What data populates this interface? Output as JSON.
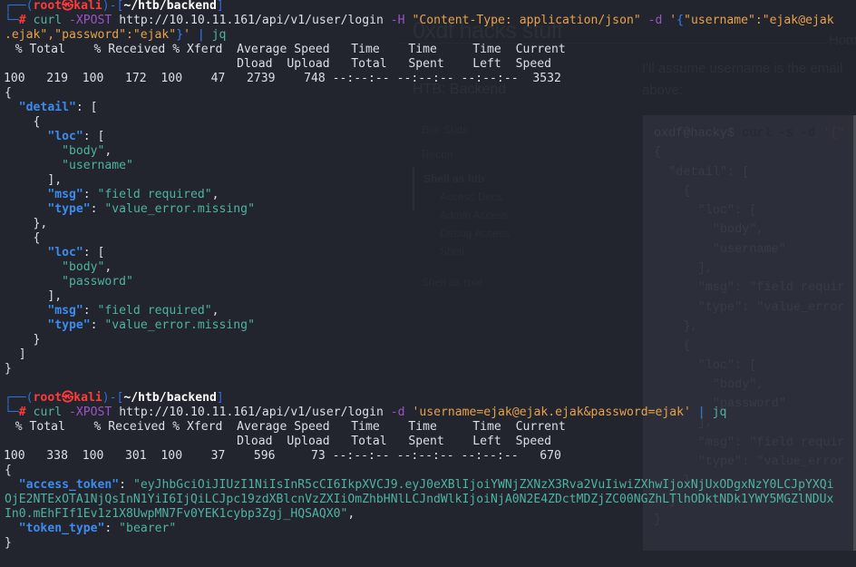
{
  "background_page": {
    "site_title": "0xdf hacks stuff",
    "nav_home": "Hom",
    "post_title": "HTB: Backend",
    "intro_text": "I'll assume username is the email above:",
    "toc": {
      "items": [
        {
          "label": "Box Stats",
          "level": 1
        },
        {
          "label": "Recon",
          "level": 1
        },
        {
          "label": "Shell as htb",
          "level": 1,
          "active": true
        },
        {
          "label": "Access Docs",
          "level": 2
        },
        {
          "label": "Admin Access",
          "level": 2
        },
        {
          "label": "Debug Access",
          "level": 2
        },
        {
          "label": "Shell",
          "level": 2
        },
        {
          "label": "Shell as root",
          "level": 1
        }
      ]
    },
    "code_block": {
      "prompt": "oxdf@hacky$",
      "command": " curl -s -d ",
      "arg": "'{\"",
      "lines": [
        "{",
        "  \"detail\": [",
        "    {",
        "      \"loc\": [",
        "        \"body\",",
        "        \"username\"",
        "      ],",
        "      \"msg\": \"field requir",
        "      \"type\": \"value_error",
        "    },",
        "    {",
        "      \"loc\": [",
        "        \"body\",",
        "        \"password\"",
        "      ],",
        "      \"msg\": \"field requir",
        "      \"type\": \"value_error",
        "    }",
        "  ]",
        "}"
      ]
    }
  },
  "terminal": {
    "prompt": {
      "user": "root",
      "at_symbol": "㉿",
      "host": "kali",
      "cwd": "~/htb/backend",
      "hash": "#"
    },
    "command1": {
      "program": "curl",
      "flag1": "-XPOST",
      "url": "http://10.10.11.161/api/v1/user/login",
      "flag2": "-H",
      "header": "\"Content-Type: application/json\"",
      "flag3": "-d",
      "body_open": "'",
      "brace": "{",
      "body_line1": "\"username\":\"ejak@ejak",
      "body_line2": ".ejak\",\"password\":\"ejak\"",
      "brace_close": "}",
      "body_close": "'",
      "pipe": "|",
      "pipe_to": "jq"
    },
    "progress_header1": "  % Total    % Received % Xferd  Average Speed   Time    Time     Time  Current",
    "progress_header2": "                                 Dload  Upload   Total   Spent    Left  Speed",
    "progress1": "100   219  100   172  100    47   2739    748 --:--:-- --:--:-- --:--:--  3532",
    "response1": {
      "detail": [
        {
          "loc": [
            "body",
            "username"
          ],
          "msg": "field required",
          "type": "value_error.missing"
        },
        {
          "loc": [
            "body",
            "password"
          ],
          "msg": "field required",
          "type": "value_error.missing"
        }
      ]
    },
    "command2": {
      "program": "curl",
      "flag1": "-XPOST",
      "url": "http://10.10.11.161/api/v1/user/login",
      "flag2": "-d",
      "body": "'username=ejak@ejak.ejak&password=ejak'",
      "pipe": "|",
      "pipe_to": "jq"
    },
    "progress2": "100   338  100   301  100    37    596     73 --:--:-- --:--:-- --:--:--   670",
    "response2": {
      "access_token_line1": "\"eyJhbGciOiJIUzI1NiIsInR5cCI6IkpXVCJ9.eyJ0eXBlIjoiYWNjZXNzX3Rva2VuIiwiZXhwIjoxNjUxODgxNzY0LCJpYXQi",
      "access_token_line2": "OjE2NTExOTA1NjQsInN1YiI6IjQiLCJpc19zdXBlcnVzZXIiOmZhbHNlLCJndWlkIjoiNjA0N2E4ZDctMDZjZC00NGZhLTlhODktNDk1YWY5MGZlNDUx",
      "access_token_line3": "In0.mEhFIf1Ev1z1X8UwpMN7Fv0YEK1cybp3Zgj_HQSAQX0\"",
      "token_type": "\"bearer\""
    },
    "json_keys": {
      "detail": "\"detail\"",
      "loc": "\"loc\"",
      "msg": "\"msg\"",
      "type": "\"type\"",
      "access_token": "\"access_token\"",
      "token_type": "\"token_type\""
    },
    "json_values": {
      "body": "\"body\"",
      "username": "\"username\"",
      "password": "\"password\"",
      "field_required": "\"field required\"",
      "value_error_missing": "\"value_error.missing\""
    }
  }
}
